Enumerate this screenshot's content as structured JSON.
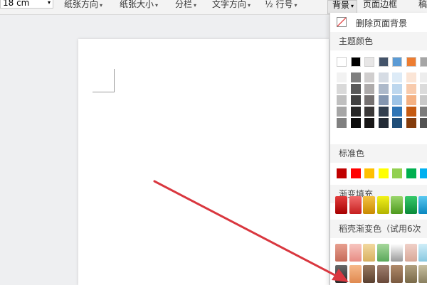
{
  "toolbar": {
    "margin_value": "18 cm",
    "items": [
      {
        "label": "纸张方向"
      },
      {
        "label": "纸张大小"
      },
      {
        "label": "分栏"
      },
      {
        "label": "文字方向"
      },
      {
        "label": "行号"
      }
    ],
    "line_number_prefix": "½",
    "background_label": "背景",
    "page_border_label": "页面边框",
    "overflow_char": "稿"
  },
  "panel": {
    "remove_bg_label": "删除页面背景",
    "theme_colors_label": "主题颜色",
    "standard_colors_label": "标准色",
    "gradient_fill_label": "渐变填充",
    "paid_gradient_label": "稻壳渐变色（试用6次",
    "theme_top_row": [
      "#ffffff",
      "#000000",
      "#e7e6e6",
      "#44546a",
      "#5b9bd5",
      "#ed7d31",
      "#a5a5a5"
    ],
    "theme_tints": [
      [
        "#f2f2f2",
        "#7f7f7f",
        "#d0cece",
        "#d6dce4",
        "#ddebf7",
        "#fbe5d6",
        "#ededed"
      ],
      [
        "#d9d9d9",
        "#595959",
        "#aeabab",
        "#adb9ca",
        "#bdd7ee",
        "#f8cbad",
        "#dbdbdb"
      ],
      [
        "#bfbfbf",
        "#404040",
        "#757171",
        "#8496b0",
        "#9dc3e6",
        "#f4b183",
        "#c9c9c9"
      ],
      [
        "#a6a6a6",
        "#262626",
        "#3a3838",
        "#323f4f",
        "#2e75b6",
        "#c55a11",
        "#7b7b7b"
      ],
      [
        "#808080",
        "#0d0d0d",
        "#171616",
        "#222a35",
        "#1f4e79",
        "#843c0c",
        "#525252"
      ]
    ],
    "standard_colors": [
      "#c00000",
      "#ff0000",
      "#ffc000",
      "#ffff00",
      "#92d050",
      "#00b050",
      "#00b0f0"
    ],
    "gradient_colors": [
      [
        "#e33b3b",
        "#a60000"
      ],
      [
        "#f26d6d",
        "#c62020"
      ],
      [
        "#f5c242",
        "#c98a00"
      ],
      [
        "#f2f21a",
        "#b3b300"
      ],
      [
        "#9ad66b",
        "#4e9a1e"
      ],
      [
        "#36c96a",
        "#0a8a3a"
      ],
      [
        "#5ac8f0",
        "#0a88c0"
      ]
    ],
    "paid_row1": [
      [
        "#e8a090",
        "#c56a58"
      ],
      [
        "#f7c6c0",
        "#e88c84"
      ],
      [
        "#f3d9a0",
        "#d8b060"
      ],
      [
        "#a7d89c",
        "#5aa85a"
      ],
      [
        "#ffffff",
        "#9a9a9a"
      ],
      [
        "#f0d0c8",
        "#d8a898"
      ],
      [
        "#d0eef8",
        "#88c8e0"
      ]
    ],
    "paid_row2": [
      [
        "#6a6a6a",
        "#2a2a2a"
      ],
      [
        "#f7b98a",
        "#e08a50"
      ],
      [
        "#9a7a60",
        "#5a4030"
      ],
      [
        "#a08070",
        "#6a4a3a"
      ],
      [
        "#b08a6a",
        "#7a5a40"
      ],
      [
        "#b0a080",
        "#7a6a48"
      ],
      [
        "#c8c0a0",
        "#8a8060"
      ]
    ]
  },
  "arrow_color": "#d9373f"
}
